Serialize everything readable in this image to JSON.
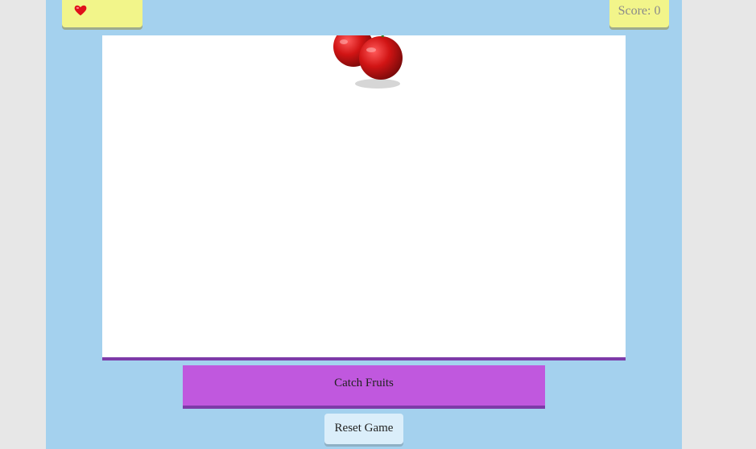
{
  "hud": {
    "lives_icon": "heart-icon",
    "score_text": "Score: 0"
  },
  "game": {
    "falling_fruit": "cherry-icon"
  },
  "controls": {
    "catch_label": "Catch Fruits",
    "reset_label": "Reset Game"
  },
  "colors": {
    "background": "#a4d1ee",
    "hud_yellow": "#f2f58a",
    "catch_purple": "#c058de",
    "heart_red": "#e0101a"
  }
}
